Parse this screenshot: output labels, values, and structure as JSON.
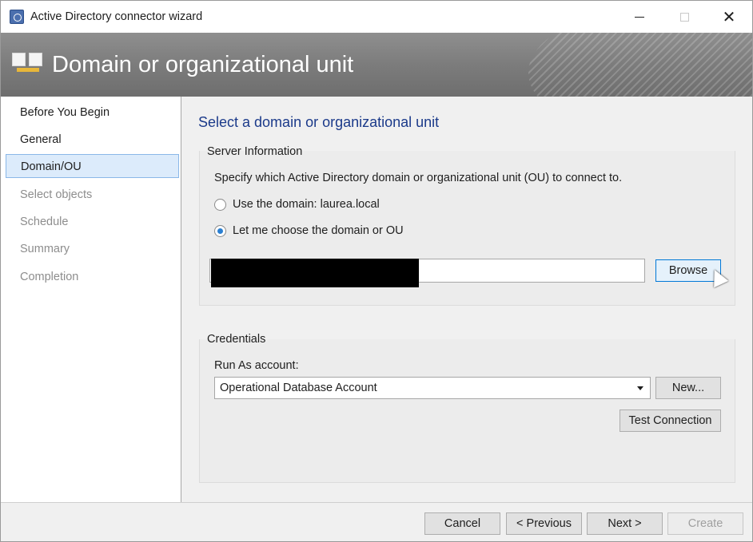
{
  "window": {
    "title": "Active Directory connector wizard",
    "minimize_glyph": "",
    "close_glyph": "✕"
  },
  "banner": {
    "title": "Domain or organizational unit",
    "icon": "wizard-pages-icon"
  },
  "nav": {
    "items": [
      {
        "label": "Before You Begin",
        "state": "enabled"
      },
      {
        "label": "General",
        "state": "enabled"
      },
      {
        "label": "Domain/OU",
        "state": "active"
      },
      {
        "label": "Select objects",
        "state": "disabled"
      },
      {
        "label": "Schedule",
        "state": "disabled"
      },
      {
        "label": "Summary",
        "state": "disabled"
      },
      {
        "label": "Completion",
        "state": "disabled"
      }
    ]
  },
  "main": {
    "heading": "Select a domain or organizational unit",
    "server_info": {
      "group_label": "Server Information",
      "description": "Specify which Active Directory domain or organizational unit (OU) to connect to.",
      "option_domain": {
        "label": "Use the domain: laurea.local",
        "checked": false
      },
      "option_choose": {
        "label": "Let me choose the domain or OU",
        "checked": true
      },
      "ou_value": "",
      "browse_label": "Browse"
    },
    "credentials": {
      "group_label": "Credentials",
      "run_as_label": "Run As account:",
      "run_as_selected": "Operational Database Account",
      "new_label": "New...",
      "test_connection_label": "Test Connection"
    }
  },
  "footer": {
    "cancel_label": "Cancel",
    "previous_label": "< Previous",
    "next_label": "Next >",
    "create_label": "Create"
  },
  "colors": {
    "heading": "#1b3a8a",
    "nav_active_bg": "#dcebfb",
    "nav_active_border": "#8ab7e8",
    "radio_checked": "#2a7fd1",
    "banner_gray": "#7c7c7c",
    "banner_icon_accent": "#e8b73a"
  }
}
